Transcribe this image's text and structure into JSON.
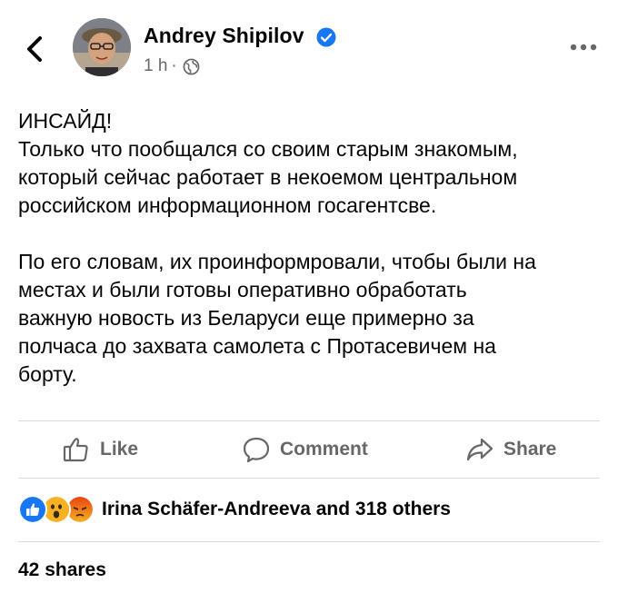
{
  "author": {
    "name": "Andrey Shipilov"
  },
  "meta": {
    "time": "1 h",
    "separator": "·"
  },
  "post": {
    "paragraph1": [
      "ИНСАЙД!",
      "Только что пообщался со своим старым знакомым,",
      "который сейчас работает в некоемом центральном",
      "российском информационном госагентсве."
    ],
    "paragraph2": [
      "По его словам, их проинформровали, чтобы были на",
      "местах и были готовы оперативно обработать",
      "важную новость из Беларуси еще примерно за",
      "полчаса до захвата самолета с Протасевичем на",
      "борту."
    ]
  },
  "actions": {
    "like": "Like",
    "comment": "Comment",
    "share": "Share"
  },
  "reactions": {
    "icons": [
      "like-icon",
      "wow-icon",
      "angry-icon"
    ],
    "text": "Irina Schäfer-Andreeva and 318 others"
  },
  "shares": {
    "text": "42 shares"
  },
  "colors": {
    "accent": "#1877f2",
    "muted": "#65676b",
    "divider": "#d8dadf"
  }
}
